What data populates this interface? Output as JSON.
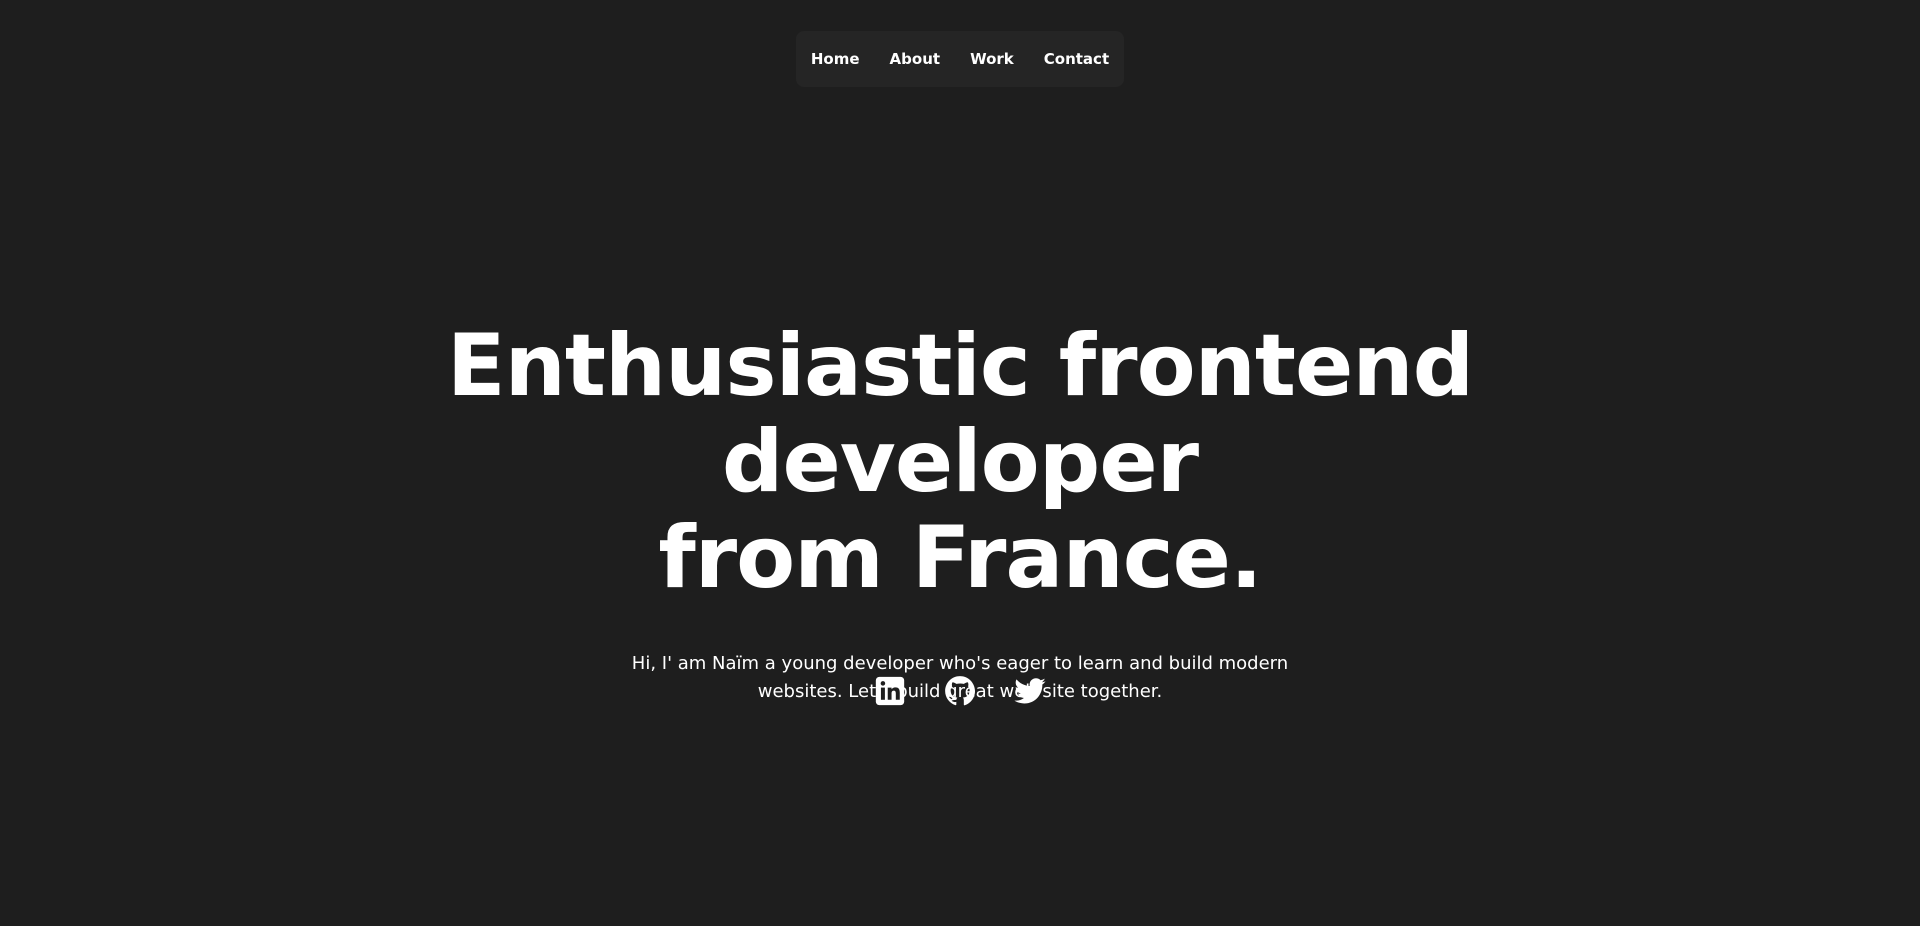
{
  "nav": {
    "items": [
      {
        "label": "Home"
      },
      {
        "label": "About"
      },
      {
        "label": "Work"
      },
      {
        "label": "Contact"
      }
    ]
  },
  "hero": {
    "title_line1": "Enthusiastic frontend developer",
    "title_line2": "from France.",
    "description": "Hi, I' am Naïm a young developer who's eager to learn and build modern websites. Let's build great web site together."
  },
  "socials": [
    {
      "icon": "linkedin-icon"
    },
    {
      "icon": "github-icon"
    },
    {
      "icon": "twitter-icon"
    }
  ],
  "colors": {
    "background": "#1e1e1e",
    "nav_background": "#252525",
    "text": "#ffffff"
  }
}
